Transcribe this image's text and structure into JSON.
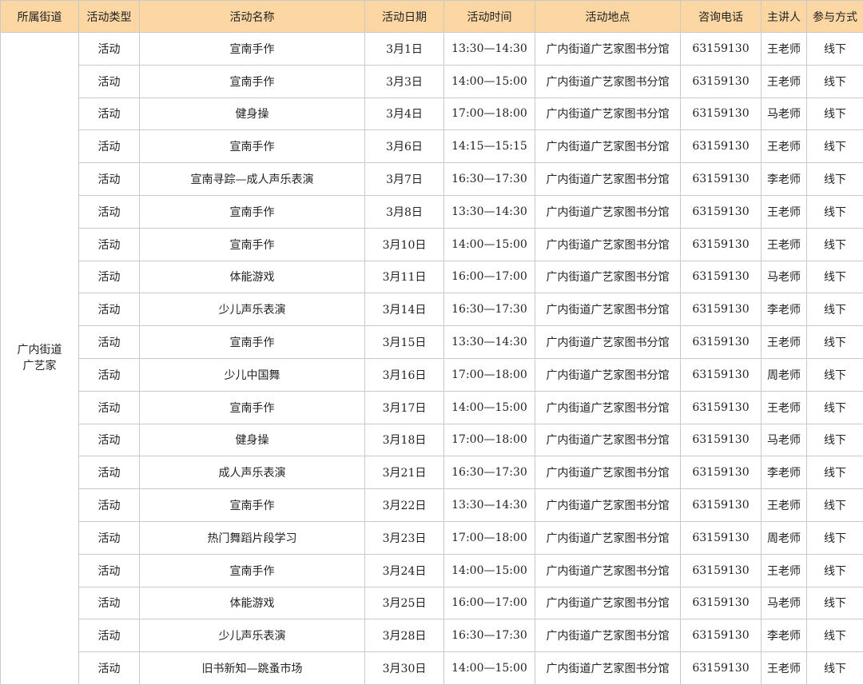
{
  "headers": [
    "所属街道",
    "活动类型",
    "活动名称",
    "活动日期",
    "活动时间",
    "活动地点",
    "咨询电话",
    "主讲人",
    "参与方式"
  ],
  "street": [
    "广内街道",
    "广艺家"
  ],
  "rows": [
    [
      "活动",
      "宣南手作",
      "3月1日",
      "13:30—14:30",
      "广内街道广艺家图书分馆",
      "63159130",
      "王老师",
      "线下"
    ],
    [
      "活动",
      "宣南手作",
      "3月3日",
      "14:00—15:00",
      "广内街道广艺家图书分馆",
      "63159130",
      "王老师",
      "线下"
    ],
    [
      "活动",
      "健身操",
      "3月4日",
      "17:00—18:00",
      "广内街道广艺家图书分馆",
      "63159130",
      "马老师",
      "线下"
    ],
    [
      "活动",
      "宣南手作",
      "3月6日",
      "14:15—15:15",
      "广内街道广艺家图书分馆",
      "63159130",
      "王老师",
      "线下"
    ],
    [
      "活动",
      "宣南寻踪—成人声乐表演",
      "3月7日",
      "16:30—17:30",
      "广内街道广艺家图书分馆",
      "63159130",
      "李老师",
      "线下"
    ],
    [
      "活动",
      "宣南手作",
      "3月8日",
      "13:30—14:30",
      "广内街道广艺家图书分馆",
      "63159130",
      "王老师",
      "线下"
    ],
    [
      "活动",
      "宣南手作",
      "3月10日",
      "14:00—15:00",
      "广内街道广艺家图书分馆",
      "63159130",
      "王老师",
      "线下"
    ],
    [
      "活动",
      "体能游戏",
      "3月11日",
      "16:00—17:00",
      "广内街道广艺家图书分馆",
      "63159130",
      "马老师",
      "线下"
    ],
    [
      "活动",
      "少儿声乐表演",
      "3月14日",
      "16:30—17:30",
      "广内街道广艺家图书分馆",
      "63159130",
      "李老师",
      "线下"
    ],
    [
      "活动",
      "宣南手作",
      "3月15日",
      "13:30—14:30",
      "广内街道广艺家图书分馆",
      "63159130",
      "王老师",
      "线下"
    ],
    [
      "活动",
      "少儿中国舞",
      "3月16日",
      "17:00—18:00",
      "广内街道广艺家图书分馆",
      "63159130",
      "周老师",
      "线下"
    ],
    [
      "活动",
      "宣南手作",
      "3月17日",
      "14:00—15:00",
      "广内街道广艺家图书分馆",
      "63159130",
      "王老师",
      "线下"
    ],
    [
      "活动",
      "健身操",
      "3月18日",
      "17:00—18:00",
      "广内街道广艺家图书分馆",
      "63159130",
      "马老师",
      "线下"
    ],
    [
      "活动",
      "成人声乐表演",
      "3月21日",
      "16:30—17:30",
      "广内街道广艺家图书分馆",
      "63159130",
      "李老师",
      "线下"
    ],
    [
      "活动",
      "宣南手作",
      "3月22日",
      "13:30—14:30",
      "广内街道广艺家图书分馆",
      "63159130",
      "王老师",
      "线下"
    ],
    [
      "活动",
      "热门舞蹈片段学习",
      "3月23日",
      "17:00—18:00",
      "广内街道广艺家图书分馆",
      "63159130",
      "周老师",
      "线下"
    ],
    [
      "活动",
      "宣南手作",
      "3月24日",
      "14:00—15:00",
      "广内街道广艺家图书分馆",
      "63159130",
      "王老师",
      "线下"
    ],
    [
      "活动",
      "体能游戏",
      "3月25日",
      "16:00—17:00",
      "广内街道广艺家图书分馆",
      "63159130",
      "马老师",
      "线下"
    ],
    [
      "活动",
      "少儿声乐表演",
      "3月28日",
      "16:30—17:30",
      "广内街道广艺家图书分馆",
      "63159130",
      "李老师",
      "线下"
    ],
    [
      "活动",
      "旧书新知—跳蚤市场",
      "3月30日",
      "14:00—15:00",
      "广内街道广艺家图书分馆",
      "63159130",
      "王老师",
      "线下"
    ]
  ],
  "colors": {
    "header_bg": "#fcd7a3",
    "border": "#c9c9c9",
    "text": "#222222"
  }
}
